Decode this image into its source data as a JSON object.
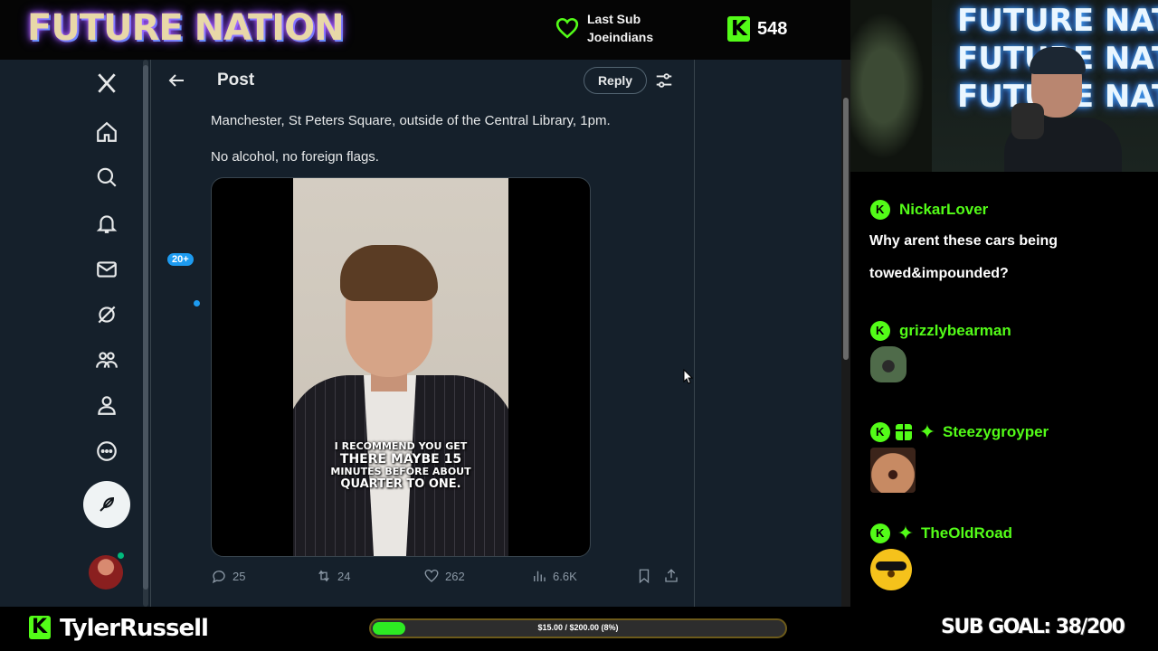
{
  "stream": {
    "brand_title": "FUTURE NATION",
    "last_sub_label": "Last Sub",
    "last_sub_name": "Joeindians",
    "follower_count": "548",
    "accent_color": "#53fc18"
  },
  "camera": {
    "sign_lines": [
      "FUTURE NATION",
      "FUTURE NATION",
      "FUTURE NATION"
    ]
  },
  "twitter": {
    "nav_icons": [
      "x-logo-icon",
      "home-icon",
      "search-icon",
      "bell-icon",
      "mail-icon",
      "grok-icon",
      "communities-icon",
      "profile-icon",
      "more-icon"
    ],
    "messages_badge": "20+",
    "header_title": "Post",
    "reply_label": "Reply",
    "tweet_lines": [
      "Manchester, St Peters Square, outside of the Central Library, 1pm.",
      "No alcohol, no foreign flags."
    ],
    "video_caption": [
      "I RECOMMEND YOU GET",
      "THERE MAYBE 15",
      "MINUTES BEFORE ABOUT",
      "QUARTER TO ONE."
    ],
    "stats": {
      "replies": "25",
      "reposts": "24",
      "likes": "262",
      "views": "6.6K"
    }
  },
  "chat": {
    "messages": [
      {
        "user": "NickarLover",
        "text": "Why arent these cars being towed&impounded?",
        "badges": [
          "kick-icon"
        ]
      },
      {
        "user": "grizzlybearman",
        "emote": "yelling-emote",
        "badges": [
          "kick-icon"
        ]
      },
      {
        "user": "Steezygroyper",
        "emote": "face-emote",
        "badges": [
          "kick-icon",
          "gift-icon",
          "star-icon"
        ]
      },
      {
        "user": "TheOldRoad",
        "emote": "sunglasses-emote",
        "badges": [
          "kick-icon",
          "star-icon"
        ]
      }
    ]
  },
  "bottom": {
    "streamer_name": "TylerRussell",
    "goal_progress_text": "$15.00 / $200.00 (8%)",
    "goal_progress_fraction": 0.08,
    "sub_goal": "SUB GOAL: 38/200"
  }
}
